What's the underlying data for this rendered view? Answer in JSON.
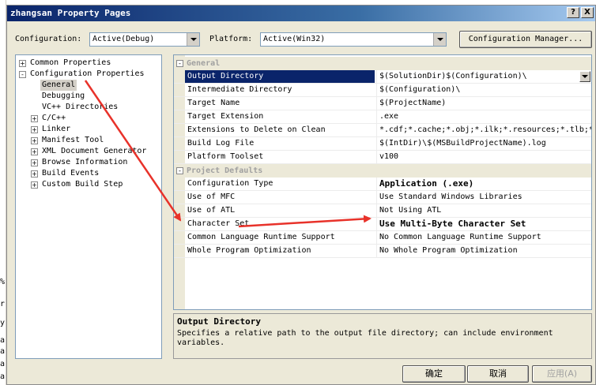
{
  "window": {
    "title": "zhangsan Property Pages",
    "help_btn": "?",
    "close_btn": "X"
  },
  "config": {
    "configuration_label": "Configuration:",
    "configuration_value": "Active(Debug)",
    "platform_label": "Platform:",
    "platform_value": "Active(Win32)",
    "manager_button": "Configuration Manager..."
  },
  "tree": {
    "items": [
      {
        "label": "Common Properties",
        "expander": "+"
      },
      {
        "label": "Configuration Properties",
        "expander": "-"
      },
      {
        "label": "General"
      },
      {
        "label": "Debugging"
      },
      {
        "label": "VC++ Directories"
      },
      {
        "label": "C/C++",
        "expander": "+"
      },
      {
        "label": "Linker",
        "expander": "+"
      },
      {
        "label": "Manifest Tool",
        "expander": "+"
      },
      {
        "label": "XML Document Generator",
        "expander": "+"
      },
      {
        "label": "Browse Information",
        "expander": "+"
      },
      {
        "label": "Build Events",
        "expander": "+"
      },
      {
        "label": "Custom Build Step",
        "expander": "+"
      }
    ]
  },
  "grid": {
    "general_category": "General",
    "general_toggle": "-",
    "general": [
      {
        "name": "Output Directory",
        "value": "$(SolutionDir)$(Configuration)\\"
      },
      {
        "name": "Intermediate Directory",
        "value": "$(Configuration)\\"
      },
      {
        "name": "Target Name",
        "value": "$(ProjectName)"
      },
      {
        "name": "Target Extension",
        "value": ".exe"
      },
      {
        "name": "Extensions to Delete on Clean",
        "value": "*.cdf;*.cache;*.obj;*.ilk;*.resources;*.tlb;*.tli;*.t"
      },
      {
        "name": "Build Log File",
        "value": "$(IntDir)\\$(MSBuildProjectName).log"
      },
      {
        "name": "Platform Toolset",
        "value": "v100"
      }
    ],
    "defaults_category": "Project Defaults",
    "defaults_toggle": "-",
    "defaults": [
      {
        "name": "Configuration Type",
        "value": "Application (.exe)"
      },
      {
        "name": "Use of MFC",
        "value": "Use Standard Windows Libraries"
      },
      {
        "name": "Use of ATL",
        "value": "Not Using ATL"
      },
      {
        "name": "Character Set",
        "value": "Use Multi-Byte Character Set"
      },
      {
        "name": "Common Language Runtime Support",
        "value": "No Common Language Runtime Support"
      },
      {
        "name": "Whole Program Optimization",
        "value": "No Whole Program Optimization"
      }
    ]
  },
  "description": {
    "title": "Output Directory",
    "text": "Specifies a relative path to the output file directory; can include environment variables."
  },
  "buttons": {
    "ok": "确定",
    "cancel": "取消",
    "apply": "应用(A)"
  },
  "behind": {
    "frag1": "%",
    "frag2": "r",
    "frag3": "y",
    "frag4": "a",
    "frag5": "a",
    "frag6": "a",
    "frag7": "a"
  },
  "colors": {
    "annotation_arrow": "#e8322a",
    "selection": "#0a246a"
  }
}
